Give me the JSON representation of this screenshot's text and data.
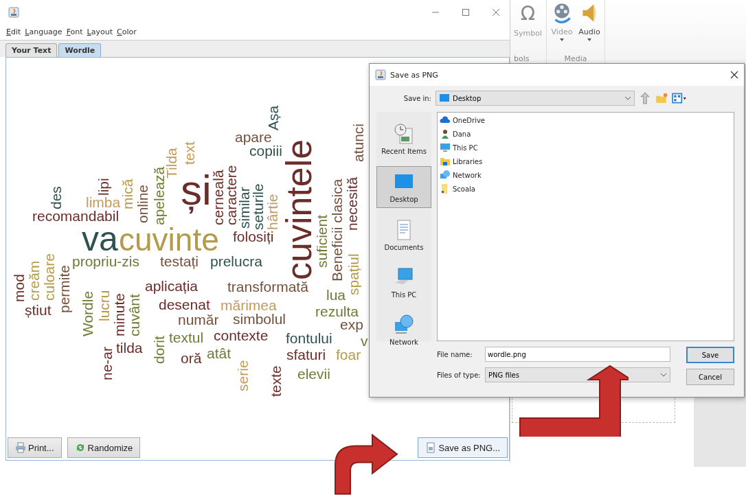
{
  "window": {
    "menu": [
      "Edit",
      "Language",
      "Font",
      "Layout",
      "Color"
    ],
    "tabs": [
      {
        "label": "Your Text",
        "selected": false
      },
      {
        "label": "Wordle",
        "selected": true
      }
    ],
    "word_cloud": [
      {
        "text": "Așa",
        "color": "#2e524f"
      },
      {
        "text": "cuvintele",
        "color": "#6b2d2a"
      },
      {
        "text": "atunci",
        "color": "#74503a"
      },
      {
        "text": "apare",
        "color": "#74503a"
      },
      {
        "text": "Beneficii clasica",
        "color": "#74503a"
      },
      {
        "text": "text",
        "color": "#c29a5e"
      },
      {
        "text": "copiii",
        "color": "#2e524f"
      },
      {
        "text": "Tilda",
        "color": "#c29a5e"
      },
      {
        "text": "caractere",
        "color": "#6b2d2a"
      },
      {
        "text": "cerneală",
        "color": "#6b2d2a"
      },
      {
        "text": "apelează",
        "color": "#6e7b35"
      },
      {
        "text": "necesită",
        "color": "#6b2d2a"
      },
      {
        "text": "seturile",
        "color": "#2e524f"
      },
      {
        "text": "lipi",
        "color": "#6b2d2a"
      },
      {
        "text": "similar",
        "color": "#2e524f"
      },
      {
        "text": "online",
        "color": "#74503a"
      },
      {
        "text": "mică",
        "color": "#b59a4a"
      },
      {
        "text": "hârtie",
        "color": "#c29a5e"
      },
      {
        "text": "des",
        "color": "#2e524f"
      },
      {
        "text": "limba",
        "color": "#c29a5e"
      },
      {
        "text": "și",
        "color": "#6b2d2a"
      },
      {
        "text": "suficient",
        "color": "#6e7b35"
      },
      {
        "text": "recomandabil",
        "color": "#6b2d2a"
      },
      {
        "text": "va",
        "color": "#2e524f"
      },
      {
        "text": "cuvinte",
        "color": "#b59a4a"
      },
      {
        "text": "folosiți",
        "color": "#6b2d2a"
      },
      {
        "text": "spațiul",
        "color": "#b59a4a"
      },
      {
        "text": "mod",
        "color": "#6b2d2a"
      },
      {
        "text": "creăm",
        "color": "#b59a4a"
      },
      {
        "text": "culoare",
        "color": "#b59a4a"
      },
      {
        "text": "permite",
        "color": "#74503a"
      },
      {
        "text": "propriu-zis",
        "color": "#6e7b35"
      },
      {
        "text": "testați",
        "color": "#74503a"
      },
      {
        "text": "prelucra",
        "color": "#2e524f"
      },
      {
        "text": "aplicația",
        "color": "#6b2d2a"
      },
      {
        "text": "transformată",
        "color": "#74503a"
      },
      {
        "text": "Wordle",
        "color": "#6e7b35"
      },
      {
        "text": "lucru",
        "color": "#b59a4a"
      },
      {
        "text": "minute",
        "color": "#6b2d2a"
      },
      {
        "text": "cuvânt",
        "color": "#6e7b35"
      },
      {
        "text": "lua",
        "color": "#6e7b35"
      },
      {
        "text": "știut",
        "color": "#6b2d2a"
      },
      {
        "text": "desenat",
        "color": "#6b2d2a"
      },
      {
        "text": "mărimea",
        "color": "#c29a5e"
      },
      {
        "text": "rezulta",
        "color": "#6e7b35"
      },
      {
        "text": "număr",
        "color": "#74503a"
      },
      {
        "text": "simbolul",
        "color": "#74503a"
      },
      {
        "text": "exp",
        "color": "#74503a"
      },
      {
        "text": "dorit",
        "color": "#6e7b35"
      },
      {
        "text": "textul",
        "color": "#6e7b35"
      },
      {
        "text": "contexte",
        "color": "#6b2d2a"
      },
      {
        "text": "fontului",
        "color": "#2e524f"
      },
      {
        "text": "v",
        "color": "#6e7b35"
      },
      {
        "text": "tilda",
        "color": "#6b2d2a"
      },
      {
        "text": "ne-ar",
        "color": "#6b2d2a"
      },
      {
        "text": "oră",
        "color": "#6b2d2a"
      },
      {
        "text": "atât",
        "color": "#6e7b35"
      },
      {
        "text": "sfaturi",
        "color": "#6b2d2a"
      },
      {
        "text": "foar",
        "color": "#b59a4a"
      },
      {
        "text": "serie",
        "color": "#c29a5e"
      },
      {
        "text": "texte",
        "color": "#6b2d2a"
      },
      {
        "text": "elevii",
        "color": "#6e7b35"
      }
    ],
    "buttons": [
      {
        "label": "Print...",
        "kind": "print"
      },
      {
        "label": "Randomize",
        "kind": "randomize"
      },
      {
        "label": "Save as PNG...",
        "kind": "save"
      }
    ]
  },
  "ribbon": {
    "groups": [
      {
        "label": "bols",
        "items": [
          {
            "label": "Symbol",
            "kind": "omega",
            "icon": "Ω"
          }
        ]
      },
      {
        "label": "Media",
        "items": [
          {
            "label": "Video",
            "kind": "video"
          },
          {
            "label": "Audio",
            "kind": "audio"
          }
        ]
      }
    ]
  },
  "dialog": {
    "title": "Save as PNG",
    "save_in_label": "Save in:",
    "save_in": "Desktop",
    "places": [
      {
        "label": "Recent Items",
        "kind": "recent",
        "selected": false
      },
      {
        "label": "Desktop",
        "kind": "desktop",
        "selected": true
      },
      {
        "label": "Documents",
        "kind": "documents",
        "selected": false
      },
      {
        "label": "This PC",
        "kind": "computer",
        "selected": false
      },
      {
        "label": "Network",
        "kind": "network",
        "selected": false
      }
    ],
    "files": [
      {
        "name": "OneDrive",
        "kind": "cloud"
      },
      {
        "name": "Dana",
        "kind": "user"
      },
      {
        "name": "This PC",
        "kind": "computer"
      },
      {
        "name": "Libraries",
        "kind": "library"
      },
      {
        "name": "Network",
        "kind": "network"
      },
      {
        "name": "Scoala",
        "kind": "folder"
      }
    ],
    "file_name_label": "File name:",
    "file_name": "wordle.png",
    "file_type_label": "Files of type:",
    "file_type": "PNG files",
    "buttons": [
      "Save",
      "Cancel"
    ]
  }
}
